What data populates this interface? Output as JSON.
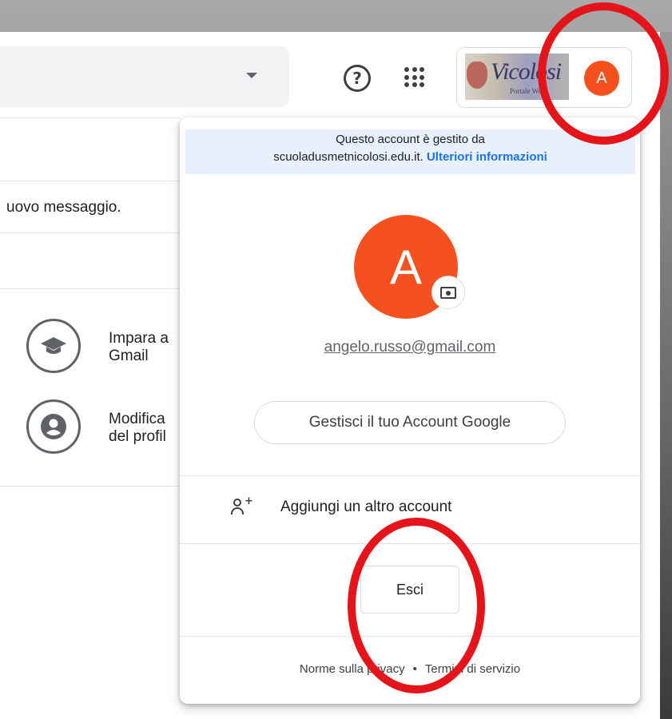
{
  "header": {
    "help_icon": "question-mark-circle",
    "apps_icon": "nine-dot-grid",
    "avatar_initial": "A"
  },
  "page": {
    "message_fragment": "uovo messaggio.",
    "tips": [
      {
        "icon": "graduation-cap-icon",
        "text": "Impara a\nGmail"
      },
      {
        "icon": "account-circle-icon",
        "text": "Modifica\ndel profil"
      }
    ]
  },
  "popup": {
    "managed_line1": "Questo account è gestito da",
    "managed_domain": "scuoladusmetnicolosi.edu.it.",
    "managed_link": "Ulteriori informazioni",
    "avatar_initial": "A",
    "email": "angelo.russo@gmail.com",
    "manage_button": "Gestisci il tuo Account Google",
    "add_account": "Aggiungi un altro account",
    "logout_button": "Esci",
    "footer": {
      "privacy": "Norme sulla privacy",
      "separator": "•",
      "terms": "Termini di servizio"
    }
  },
  "colors": {
    "avatar": "#f4511e",
    "link": "#1a73e8",
    "managed_bg": "#e8f0fe",
    "annotation": "#e4141a"
  }
}
